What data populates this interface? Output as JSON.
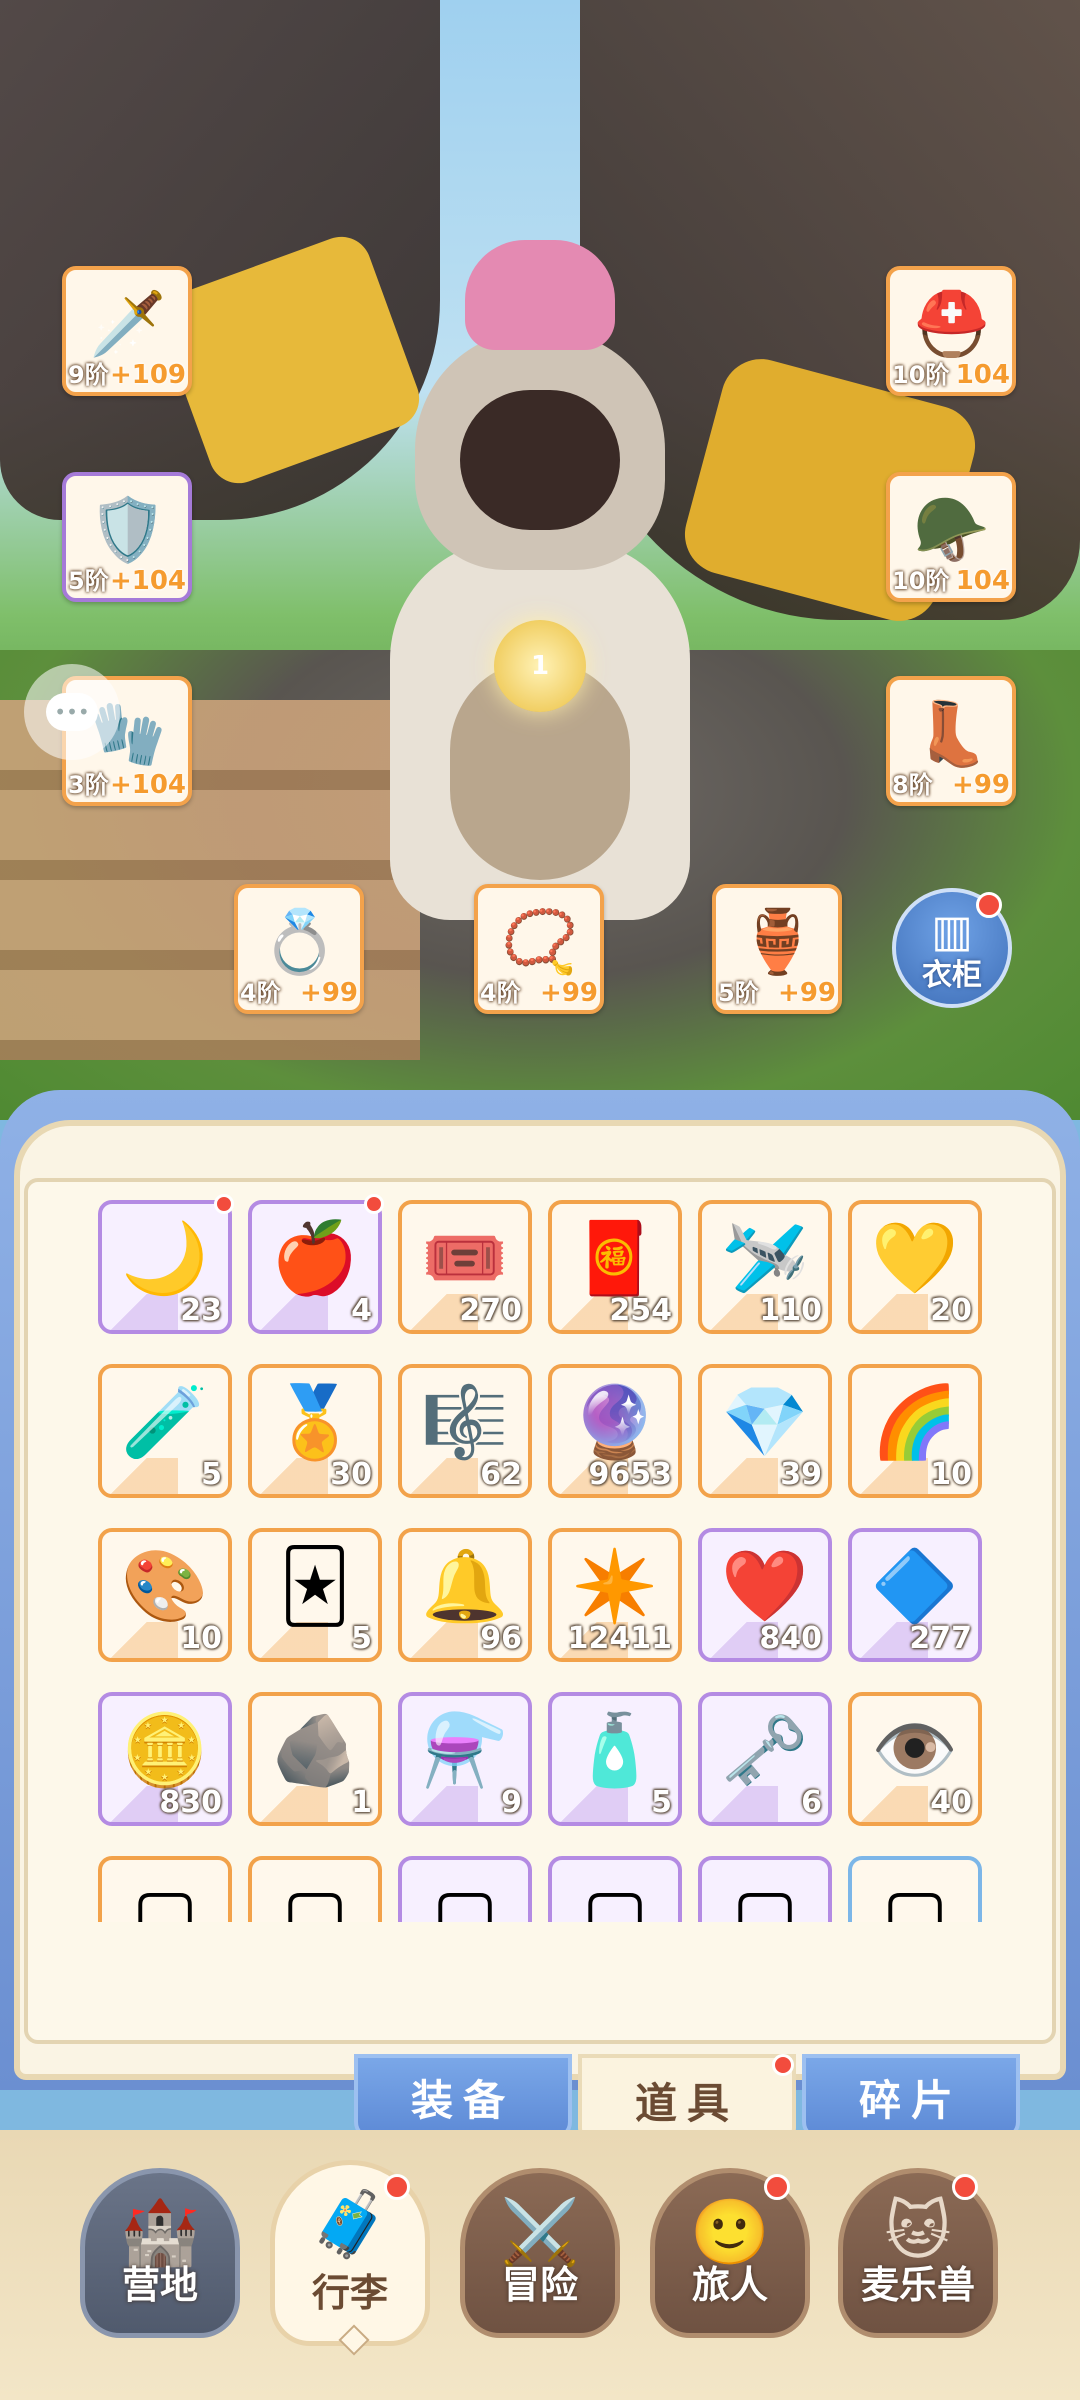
{
  "equipment": {
    "weapon": {
      "tier": "9阶",
      "plus": "+109",
      "icon": "sword-icon"
    },
    "armor": {
      "tier": "5阶",
      "plus": "+104",
      "icon": "chestplate-icon"
    },
    "gloves": {
      "tier": "3阶",
      "plus": "+104",
      "icon": "gauntlet-icon"
    },
    "helmet": {
      "tier": "10阶",
      "plus": "104",
      "icon": "helmet-icon"
    },
    "headgear": {
      "tier": "10阶",
      "plus": "104",
      "icon": "visor-helmet-icon"
    },
    "boots": {
      "tier": "8阶",
      "plus": "+99",
      "icon": "boots-icon"
    },
    "ring": {
      "tier": "4阶",
      "plus": "+99",
      "icon": "ring-icon"
    },
    "necklace": {
      "tier": "4阶",
      "plus": "+99",
      "icon": "necklace-icon"
    },
    "charm": {
      "tier": "5阶",
      "plus": "+99",
      "icon": "charm-icon"
    }
  },
  "marker": "1",
  "wardrobe_label": "衣柜",
  "items": [
    {
      "count": "23",
      "style": "purple",
      "icon": "moon-scroll-icon",
      "dot": true
    },
    {
      "count": "4",
      "style": "purple",
      "icon": "apple-icon",
      "dot": true
    },
    {
      "count": "270",
      "style": "orange",
      "icon": "ticket-icon"
    },
    {
      "count": "254",
      "style": "orange",
      "icon": "voucher-icon"
    },
    {
      "count": "110",
      "style": "orange",
      "icon": "paper-plane-icon"
    },
    {
      "count": "20",
      "style": "orange",
      "icon": "gold-gem-icon"
    },
    {
      "count": "5",
      "style": "orange",
      "icon": "blue-potion-icon"
    },
    {
      "count": "30",
      "style": "orange",
      "icon": "cat-medal-icon"
    },
    {
      "count": "62",
      "style": "orange",
      "icon": "harp-icon"
    },
    {
      "count": "9653",
      "style": "orange",
      "icon": "orb-icon"
    },
    {
      "count": "39",
      "style": "orange",
      "icon": "crystal-icon"
    },
    {
      "count": "10",
      "style": "orange",
      "icon": "rainbow-tube-icon"
    },
    {
      "count": "10",
      "style": "orange",
      "icon": "paint-bottle-icon"
    },
    {
      "count": "5",
      "style": "orange",
      "icon": "card-icon"
    },
    {
      "count": "96",
      "style": "orange",
      "icon": "bell-icon"
    },
    {
      "count": "12411",
      "style": "orange",
      "icon": "star-crystal-icon"
    },
    {
      "count": "840",
      "style": "purple",
      "icon": "heart-icon"
    },
    {
      "count": "277",
      "style": "purple",
      "icon": "purple-gem-icon"
    },
    {
      "count": "830",
      "style": "purple",
      "icon": "coin-icon"
    },
    {
      "count": "1",
      "style": "orange",
      "icon": "ore-icon"
    },
    {
      "count": "9",
      "style": "purple",
      "icon": "blue-flask-icon"
    },
    {
      "count": "5",
      "style": "purple",
      "icon": "red-flask-icon"
    },
    {
      "count": "6",
      "style": "purple",
      "icon": "key-icon"
    },
    {
      "count": "40",
      "style": "orange",
      "icon": "eye-card-icon"
    },
    {
      "count": "",
      "style": "orange",
      "icon": "partial-item-icon"
    },
    {
      "count": "",
      "style": "orange",
      "icon": "partial-item-icon"
    },
    {
      "count": "",
      "style": "purple",
      "icon": "partial-item-icon"
    },
    {
      "count": "",
      "style": "purple",
      "icon": "partial-item-icon"
    },
    {
      "count": "",
      "style": "purple",
      "icon": "partial-item-icon"
    },
    {
      "count": "",
      "style": "blue",
      "icon": "partial-item-icon"
    }
  ],
  "subtabs": {
    "equipment": "装备",
    "items": "道具",
    "fragments": "碎片"
  },
  "nav": {
    "camp": "营地",
    "luggage": "行李",
    "adventure": "冒险",
    "traveler": "旅人",
    "mellobeast": "麦乐兽"
  }
}
